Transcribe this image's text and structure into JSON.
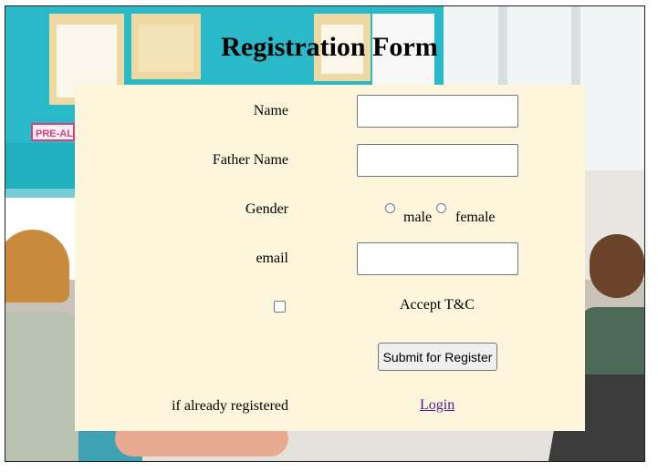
{
  "page": {
    "title": "Registration Form"
  },
  "background": {
    "sign_text": "PRE-AL",
    "colors": {
      "wall": "#2ab9c8",
      "panel": "#fdf6dd",
      "link": "#551a8b"
    }
  },
  "form": {
    "name_label": "Name",
    "name_value": "",
    "father_name_label": "Father Name",
    "father_name_value": "",
    "gender_label": "Gender",
    "gender_options": [
      "male",
      "female"
    ],
    "email_label": "email",
    "email_value": "",
    "accept_label": "Accept T&C",
    "accept_checked": false,
    "submit_label": "Submit for Register",
    "already_registered_label": "if already registered",
    "login_label": "Login"
  }
}
